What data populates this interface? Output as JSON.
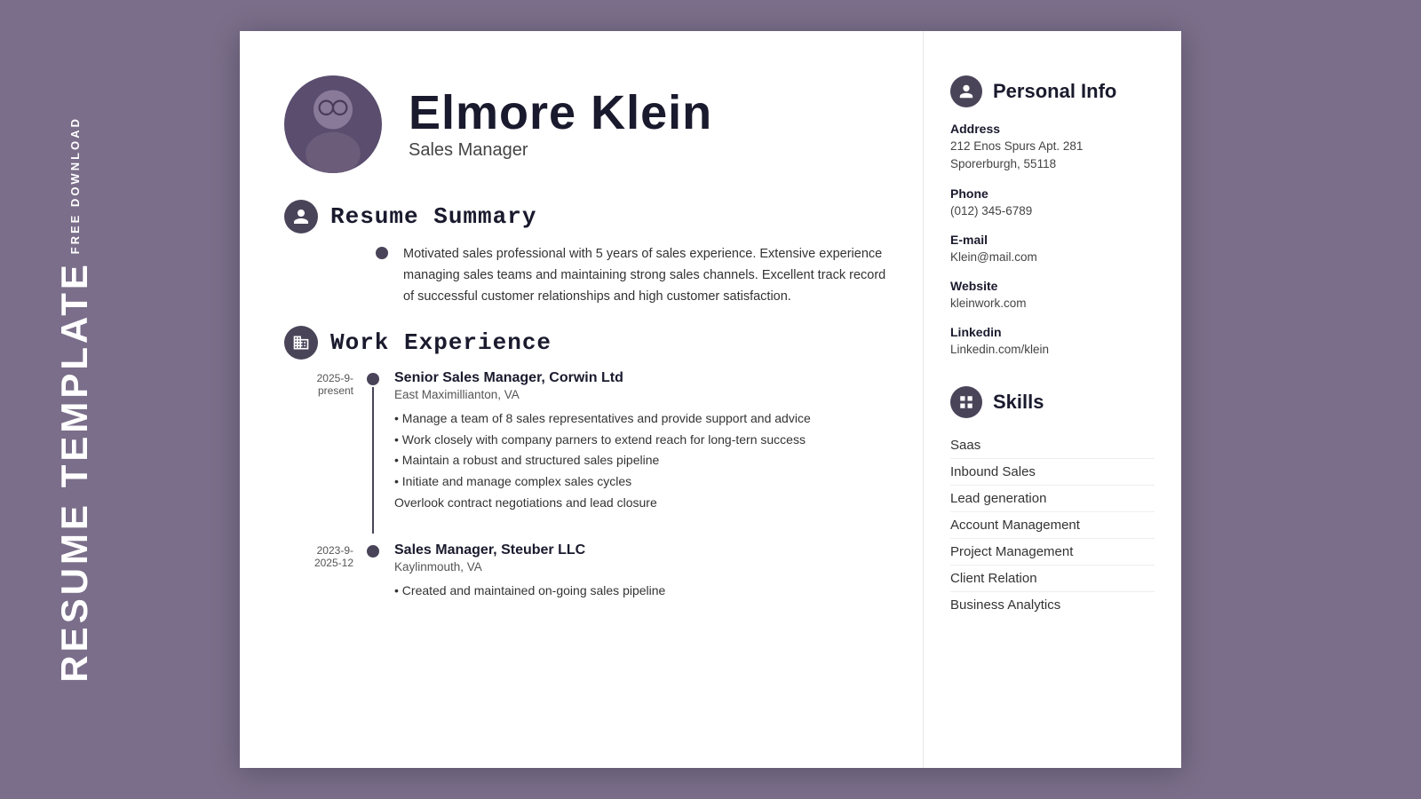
{
  "sideLabel": {
    "freeDownload": "FREE DOWNLOAD",
    "resumeTemplate": "RESUME TEMPLATE"
  },
  "header": {
    "name": "Elmore Klein",
    "jobTitle": "Sales Manager"
  },
  "sections": {
    "summary": {
      "title": "Resume Summary",
      "text": "Motivated sales professional with 5 years of sales experience. Extensive experience managing sales teams and maintaining strong sales channels. Excellent track record of successful customer relationships and high customer satisfaction."
    },
    "workExperience": {
      "title": "Work Experience",
      "jobs": [
        {
          "title": "Senior Sales Manager, Corwin Ltd",
          "location": "East Maximillianton, VA",
          "dateStart": "2025-9-",
          "dateEnd": "present",
          "bullets": [
            "• Manage a team of 8 sales representatives and provide support and advice",
            "• Work closely with company parners to extend reach for long-tern success",
            "• Maintain a robust and structured sales pipeline",
            "• Initiate and manage complex sales cycles",
            "Overlook contract negotiations and lead closure"
          ]
        },
        {
          "title": "Sales Manager, Steuber LLC",
          "location": "Kaylinmouth, VA",
          "dateStart": "2023-9-",
          "dateEnd": "2025-12",
          "bullets": [
            "• Created and maintained on-going sales pipeline"
          ]
        }
      ]
    }
  },
  "sidebar": {
    "personalInfo": {
      "title": "Personal Info",
      "address": {
        "label": "Address",
        "line1": "212 Enos Spurs Apt. 281",
        "line2": "Sporerburgh, 55118"
      },
      "phone": {
        "label": "Phone",
        "value": "(012) 345-6789"
      },
      "email": {
        "label": "E-mail",
        "value": "Klein@mail.com"
      },
      "website": {
        "label": "Website",
        "value": "kleinwork.com"
      },
      "linkedin": {
        "label": "Linkedin",
        "value": "Linkedin.com/klein"
      }
    },
    "skills": {
      "title": "Skills",
      "items": [
        "Saas",
        "Inbound Sales",
        "Lead generation",
        "Account Management",
        "Project Management",
        "Client Relation",
        "Business Analytics"
      ]
    }
  }
}
